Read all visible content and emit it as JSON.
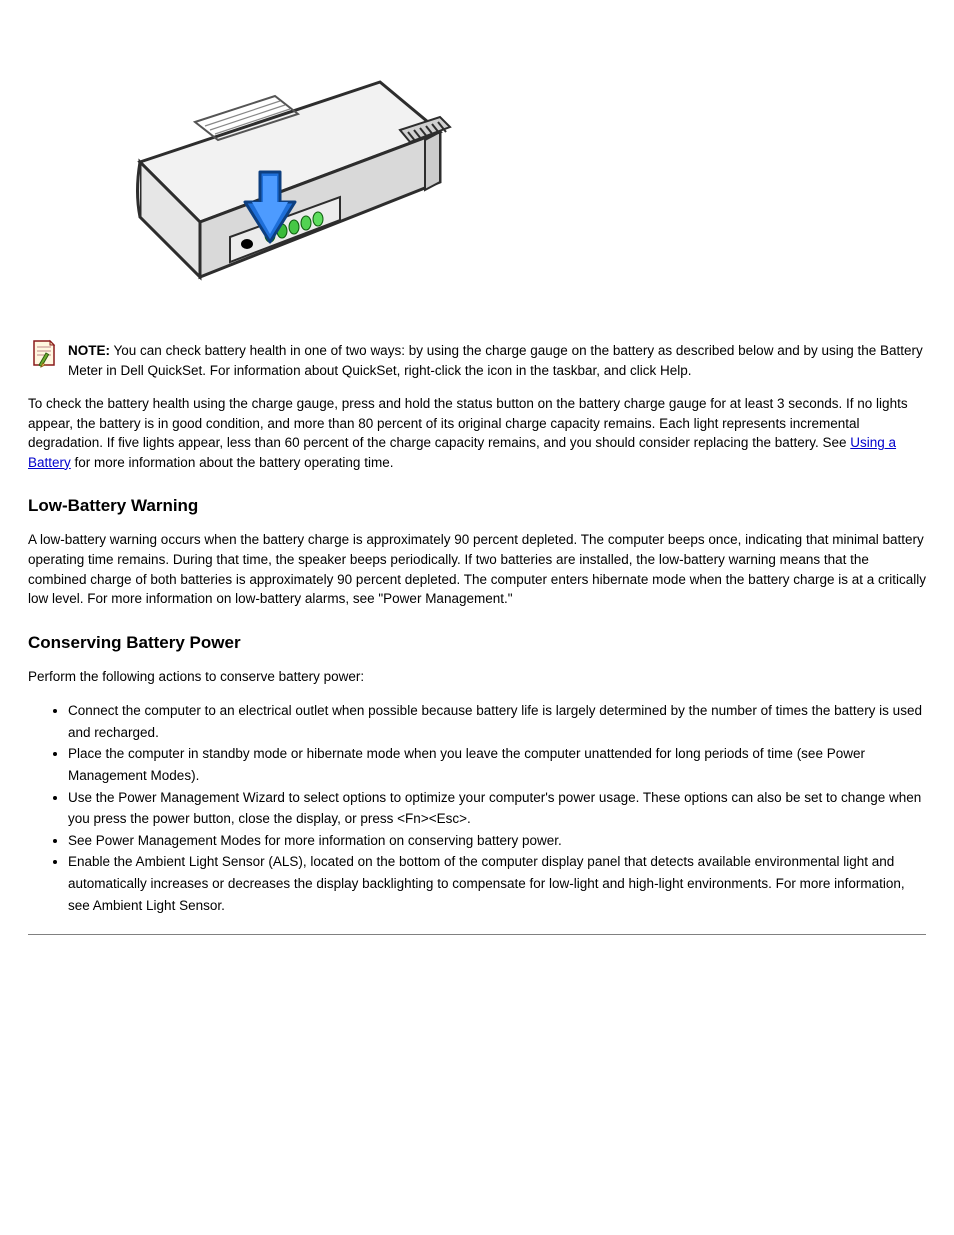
{
  "figure": {
    "alt": "Laptop battery with charge gauge button and indicator lights"
  },
  "note": {
    "label": "NOTE:",
    "body": "You can check battery health in one of two ways: by using the charge gauge on the battery as described below and by using the Battery Meter in Dell QuickSet. For information about QuickSet, right-click the icon in the taskbar, and click Help."
  },
  "health_para_1": "To check the battery health using the charge gauge, press and hold the status button on the battery charge gauge for at least 3 seconds. If no lights appear, the battery is in good condition, and more than 80 percent of its original charge capacity remains. Each light represents incremental degradation. If five lights appear, less than 60 percent of the charge capacity remains, and you should consider replacing the battery. See",
  "health_link": "Using a Battery",
  "health_para_1_tail": " for more information about the battery operating time.",
  "low_battery": {
    "heading": "Low-Battery Warning",
    "para": "A low-battery warning occurs when the battery charge is approximately 90 percent depleted. The computer beeps once, indicating that minimal battery operating time remains. During that time, the speaker beeps periodically. If two batteries are installed, the low-battery warning means that the combined charge of both batteries is approximately 90 percent depleted. The computer enters hibernate mode when the battery charge is at a critically low level. For more information on low-battery alarms, see \"Power Management.\""
  },
  "conserve": {
    "heading": "Conserving Battery Power",
    "intro": "Perform the following actions to conserve battery power:",
    "items": [
      "Connect the computer to an electrical outlet when possible because battery life is largely determined by the number of times the battery is used and recharged.",
      "Place the computer in standby mode or hibernate mode when you leave the computer unattended for long periods of time (see Power Management Modes).",
      "Use the Power Management Wizard to select options to optimize your computer's power usage. These options can also be set to change when you press the power button, close the display, or press <Fn><Esc>.",
      "See Power Management Modes for more information on conserving battery power.",
      "Enable the Ambient Light Sensor (ALS), located on the bottom of the computer display panel that detects available environmental light and automatically increases or decreases the display backlighting to compensate for low-light and high-light environments. For more information, see Ambient Light Sensor."
    ]
  }
}
